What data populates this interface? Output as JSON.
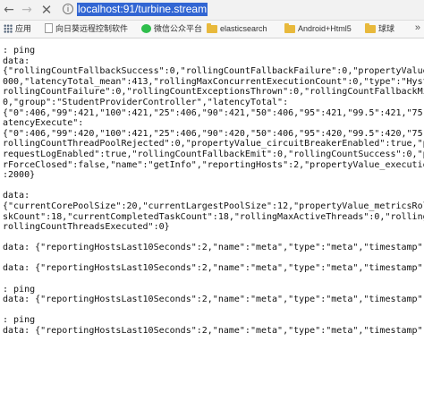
{
  "toolbar": {
    "back_glyph": "←",
    "forward_glyph": "→",
    "close_glyph": "✕",
    "info_glyph": "i",
    "url": "localhost:91/turbine.stream"
  },
  "bookmarks": {
    "apps_label": "应用",
    "items": [
      {
        "label": "向日葵远程控制软件",
        "icon": "file-icon"
      },
      {
        "label": "微信公众平台",
        "icon": "wechat-icon"
      },
      {
        "label": "elasticsearch",
        "icon": "folder-icon"
      },
      {
        "label": "Android+Html5",
        "icon": "folder-icon"
      },
      {
        "label": "球球",
        "icon": "folder-icon"
      }
    ],
    "more_glyph": "»"
  },
  "stream_lines": [
    ": ping",
    "data:",
    "{\"rollingCountFallbackSuccess\":0,\"rollingCountFallbackFailure\":0,\"propertyValue_",
    "000,\"latencyTotal_mean\":413,\"rollingMaxConcurrentExecutionCount\":0,\"type\":\"Hystr",
    "rollingCountFailure\":0,\"rollingCountExceptionsThrown\":0,\"rollingCountFallbackMis",
    "0,\"group\":\"StudentProviderController\",\"latencyTotal\":",
    "{\"0\":406,\"99\":421,\"100\":421,\"25\":406,\"90\":421,\"50\":406,\"95\":421,\"99.5\":421,\"75\":",
    "atencyExecute\":",
    "{\"0\":406,\"99\":420,\"100\":421,\"25\":406,\"90\":420,\"50\":406,\"95\":420,\"99.5\":420,\"75\":",
    "rollingCountThreadPoolRejected\":0,\"propertyValue_circuitBreakerEnabled\":true,\"pr",
    "requestLogEnabled\":true,\"rollingCountFallbackEmit\":0,\"rollingCountSuccess\":0,\"pr",
    "rForceClosed\":false,\"name\":\"getInfo\",\"reportingHosts\":2,\"propertyValue_execution",
    ":2000}",
    "",
    "data:",
    "{\"currentCorePoolSize\":20,\"currentLargestPoolSize\":12,\"propertyValue_metricsRoll",
    "skCount\":18,\"currentCompletedTaskCount\":18,\"rollingMaxActiveThreads\":0,\"rollingC",
    "rollingCountThreadsExecuted\":0}",
    "",
    "data: {\"reportingHostsLast10Seconds\":2,\"name\":\"meta\",\"type\":\"meta\",\"timestamp\":14",
    "",
    "data: {\"reportingHostsLast10Seconds\":2,\"name\":\"meta\",\"type\":\"meta\",\"timestamp\":14",
    "",
    ": ping",
    "data: {\"reportingHostsLast10Seconds\":2,\"name\":\"meta\",\"type\":\"meta\",\"timestamp\":14",
    "",
    ": ping",
    "data: {\"reportingHostsLast10Seconds\":2,\"name\":\"meta\",\"type\":\"meta\",\"timestamp\":14"
  ]
}
